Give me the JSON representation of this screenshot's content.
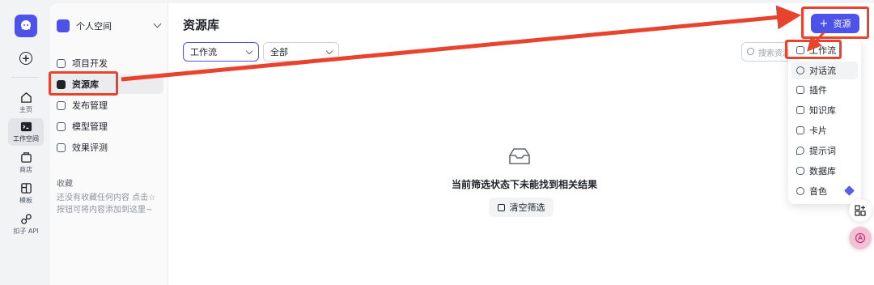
{
  "rail": {
    "items": [
      {
        "label": "主页",
        "icon": "home-icon"
      },
      {
        "label": "工作空间",
        "icon": "terminal-icon"
      },
      {
        "label": "商店",
        "icon": "store-icon"
      },
      {
        "label": "模板",
        "icon": "template-icon"
      },
      {
        "label": "扣子 API",
        "icon": "api-icon"
      }
    ]
  },
  "sidebar": {
    "space_name": "个人空间",
    "nav": [
      {
        "label": "项目开发",
        "icon": "project-icon"
      },
      {
        "label": "资源库",
        "icon": "library-icon"
      },
      {
        "label": "发布管理",
        "icon": "rocket-icon"
      },
      {
        "label": "模型管理",
        "icon": "cube-icon"
      },
      {
        "label": "效果评测",
        "icon": "gauge-icon"
      }
    ],
    "favorites_title": "收藏",
    "favorites_empty": "还没有收藏任何内容 点击☆按钮可将内容添加到这里~"
  },
  "main": {
    "title": "资源库",
    "filter_type": "工作流",
    "filter_scope": "全部",
    "search_placeholder": "搜索资源",
    "empty_text": "当前筛选状态下未能找到相关结果",
    "clear_button": "清空筛选"
  },
  "create": {
    "button_label": "资源",
    "menu": [
      {
        "label": "工作流",
        "icon": "workflow-icon"
      },
      {
        "label": "对话流",
        "icon": "chatflow-icon"
      },
      {
        "label": "插件",
        "icon": "plugin-icon"
      },
      {
        "label": "知识库",
        "icon": "knowledge-icon"
      },
      {
        "label": "卡片",
        "icon": "card-icon"
      },
      {
        "label": "提示词",
        "icon": "prompt-icon"
      },
      {
        "label": "数据库",
        "icon": "database-icon"
      },
      {
        "label": "音色",
        "icon": "voice-icon"
      }
    ]
  },
  "colors": {
    "accent": "#4d53e8",
    "annotation": "#e8432d"
  }
}
